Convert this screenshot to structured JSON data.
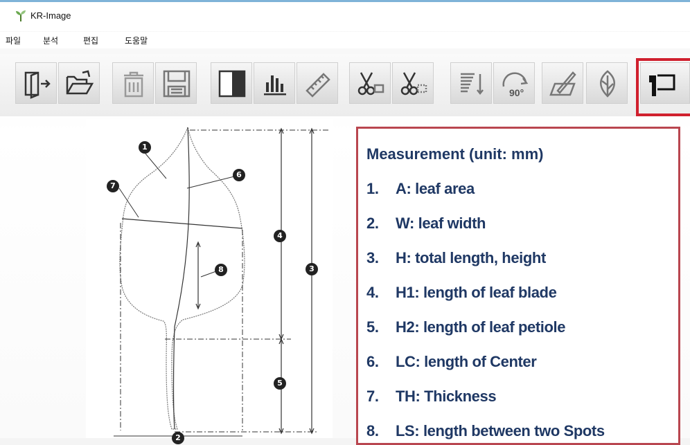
{
  "window": {
    "title": "KR-Image"
  },
  "menu": {
    "items": [
      "파일",
      "분석",
      "편집",
      "도움말"
    ]
  },
  "toolbar": {
    "buttons": [
      "exit-icon",
      "open-folder-icon",
      "delete-icon",
      "save-icon",
      "contrast-icon",
      "histogram-icon",
      "ruler-icon",
      "cut-icon",
      "cut-area-icon",
      "sort-icon",
      "rotate-90-icon",
      "draw-icon",
      "leaf-icon",
      "measure-flag-icon"
    ],
    "rotate_label": "90°",
    "highlight_color": "#d0202e"
  },
  "diagram": {
    "markers": [
      "1",
      "2",
      "3",
      "4",
      "5",
      "6",
      "7",
      "8"
    ]
  },
  "measurement": {
    "title": "Measurement (unit: mm)",
    "items": [
      {
        "num": "1.",
        "text": "A: leaf area"
      },
      {
        "num": "2.",
        "text": "W: leaf width"
      },
      {
        "num": "3.",
        "text": "H: total length, height"
      },
      {
        "num": "4.",
        "text": "H1: length of leaf blade"
      },
      {
        "num": "5.",
        "text": "H2: length of leaf petiole"
      },
      {
        "num": "6.",
        "text": "LC: length of Center"
      },
      {
        "num": "7.",
        "text": "TH: Thickness"
      },
      {
        "num": "8.",
        "text": "LS: length between two Spots"
      }
    ],
    "text_color": "#1f3864",
    "border_color": "#b9464f"
  }
}
